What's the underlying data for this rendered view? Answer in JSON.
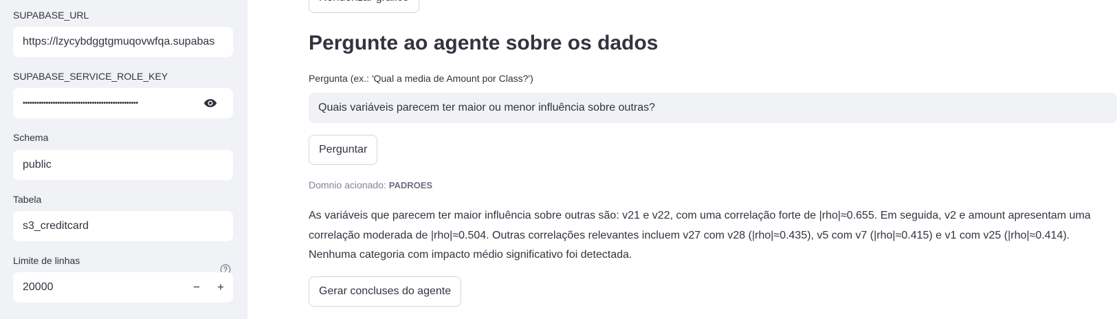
{
  "sidebar": {
    "supabase_url": {
      "label": "SUPABASE_URL",
      "value": "https://lzycybdggtgmuqovwfqa.supabas"
    },
    "service_role_key": {
      "label": "SUPABASE_SERVICE_ROLE_KEY",
      "value": "••••••••••••••••••••••••••••••••••••••••••••••••••"
    },
    "schema": {
      "label": "Schema",
      "value": "public"
    },
    "table": {
      "label": "Tabela",
      "value": "s3_creditcard"
    },
    "row_limit": {
      "label": "Limite de linhas",
      "value": "20000",
      "decrement": "−",
      "increment": "+"
    }
  },
  "main": {
    "render_button_label": "Renderizar gráfico",
    "heading": "Pergunte ao agente sobre os dados",
    "question": {
      "label": "Pergunta (ex.: 'Qual a media de Amount por Class?')",
      "value": "Quais variáveis parecem ter maior ou menor influência sobre outras?"
    },
    "ask_button_label": "Perguntar",
    "domain": {
      "prefix": "Domnio acionado: ",
      "value": "PADROES"
    },
    "answer": "As variáveis que parecem ter maior influência sobre outras são: v21 e v22, com uma correlação forte de |rho|≈0.655. Em seguida, v2 e amount apresentam uma correlação moderada de |rho|≈0.504. Outras correlações relevantes incluem v27 com v28 (|rho|≈0.435), v5 com v7 (|rho|≈0.415) e v1 com v25 (|rho|≈0.414). Nenhuma categoria com impacto médio significativo foi detectada.",
    "conclusions_button_label": "Gerar concluses do agente"
  },
  "icons": {
    "password_toggle": "eye-icon",
    "help": "question-circle-icon"
  },
  "colors": {
    "sidebar_bg": "#f0f2f6",
    "text": "#31333f",
    "muted": "#808495"
  }
}
